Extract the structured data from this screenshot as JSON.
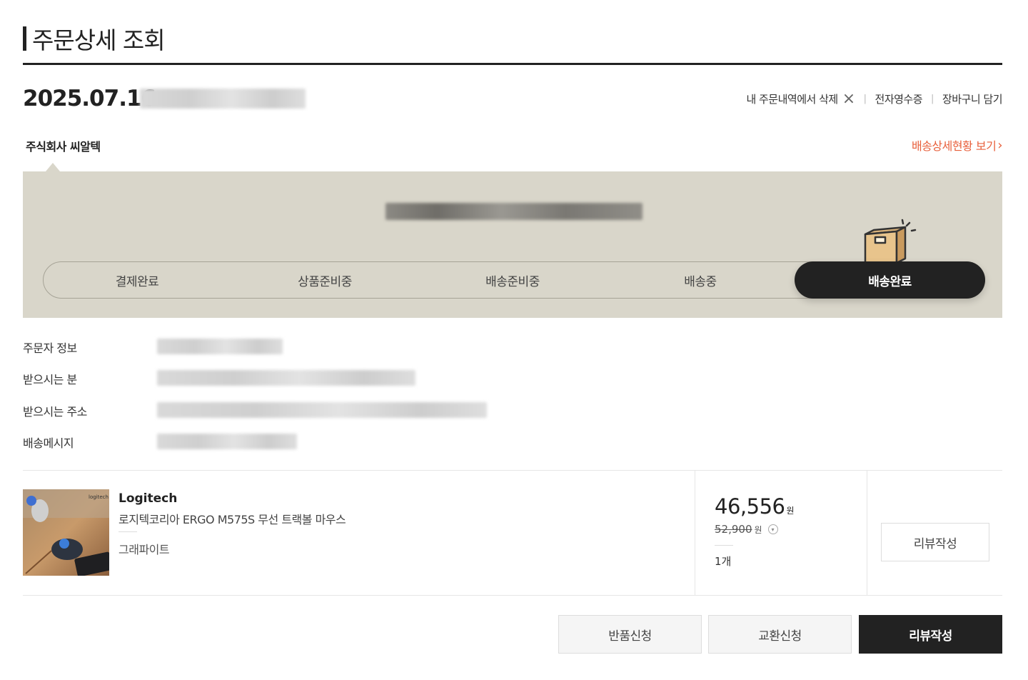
{
  "page": {
    "title": "주문상세 조회"
  },
  "order": {
    "date": "2025.07.16"
  },
  "actions": {
    "delete_label": "내 주문내역에서 삭제",
    "receipt_label": "전자영수증",
    "cart_label": "장바구니 담기"
  },
  "seller": {
    "name": "주식회사 씨알텍"
  },
  "tracking": {
    "link_label": "배송상세현황 보기"
  },
  "steps": [
    "결제완료",
    "상품준비중",
    "배송준비중",
    "배송중",
    "배송완료"
  ],
  "active_step": 4,
  "info": {
    "orderer_label": "주문자 정보",
    "recipient_label": "받으시는 분",
    "address_label": "받으시는 주소",
    "message_label": "배송메시지"
  },
  "product": {
    "brand": "Logitech",
    "name": "로지텍코리아 ERGO M575S 무선 트랙볼 마우스",
    "option": "그래파이트",
    "price": "46,556",
    "price_unit": "원",
    "original_price": "52,900",
    "quantity": "1개",
    "review_label": "리뷰작성",
    "image_label": "logitech"
  },
  "buttons": {
    "return_label": "반품신청",
    "exchange_label": "교환신청",
    "review_label": "리뷰작성"
  },
  "colors": {
    "accent": "#e8603c",
    "panel": "#d9d6ca",
    "dark": "#222222"
  }
}
